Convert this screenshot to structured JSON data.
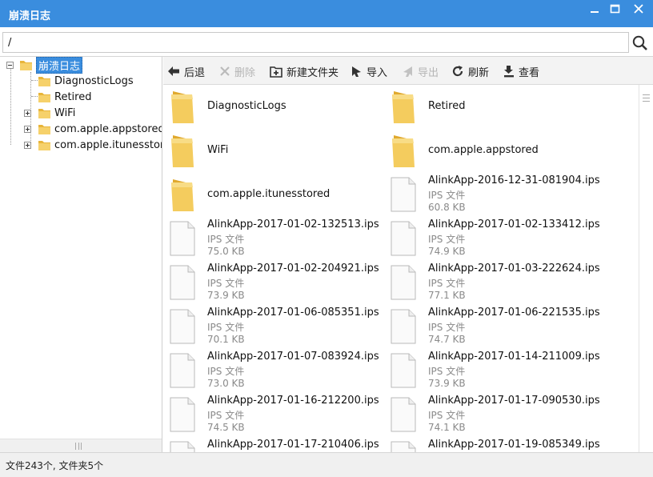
{
  "window": {
    "title": "崩溃日志",
    "accent_color": "#3a8dde",
    "controls": [
      "minimize-icon",
      "maximize-icon",
      "close-icon"
    ]
  },
  "path_bar": {
    "value": "/",
    "search_icon": "search-icon"
  },
  "tree": {
    "root": {
      "label": "崩溃日志",
      "expanded": true,
      "selected": true
    },
    "children": [
      {
        "label": "DiagnosticLogs",
        "expandable": false
      },
      {
        "label": "Retired",
        "expandable": false
      },
      {
        "label": "WiFi",
        "expandable": true
      },
      {
        "label": "com.apple.appstored",
        "expandable": true
      },
      {
        "label": "com.apple.itunesstored",
        "expandable": true
      }
    ]
  },
  "toolbar": {
    "back": {
      "label": "后退",
      "icon": "arrow-left-icon",
      "enabled": true
    },
    "delete": {
      "label": "删除",
      "icon": "delete-x-icon",
      "enabled": false
    },
    "new_folder": {
      "label": "新建文件夹",
      "icon": "new-folder-icon",
      "enabled": true
    },
    "import": {
      "label": "导入",
      "icon": "import-icon",
      "enabled": true
    },
    "export": {
      "label": "导出",
      "icon": "export-icon",
      "enabled": false
    },
    "refresh": {
      "label": "刷新",
      "icon": "refresh-icon",
      "enabled": true
    },
    "view": {
      "label": "查看",
      "icon": "view-icon",
      "enabled": true
    }
  },
  "files": {
    "folders": [
      {
        "name": "DiagnosticLogs"
      },
      {
        "name": "Retired"
      },
      {
        "name": "WiFi"
      },
      {
        "name": "com.apple.appstored"
      },
      {
        "name": "com.apple.itunesstored"
      }
    ],
    "file_type_label": "IPS 文件",
    "files": [
      {
        "name": "AlinkApp-2016-12-31-081904.ips",
        "size": "60.8 KB"
      },
      {
        "name": "AlinkApp-2017-01-02-132513.ips",
        "size": "75.0 KB"
      },
      {
        "name": "AlinkApp-2017-01-02-133412.ips",
        "size": "74.9 KB"
      },
      {
        "name": "AlinkApp-2017-01-02-204921.ips",
        "size": "73.9 KB"
      },
      {
        "name": "AlinkApp-2017-01-03-222624.ips",
        "size": "77.1 KB"
      },
      {
        "name": "AlinkApp-2017-01-06-085351.ips",
        "size": "70.1 KB"
      },
      {
        "name": "AlinkApp-2017-01-06-221535.ips",
        "size": "74.7 KB"
      },
      {
        "name": "AlinkApp-2017-01-07-083924.ips",
        "size": "73.0 KB"
      },
      {
        "name": "AlinkApp-2017-01-14-211009.ips",
        "size": "73.9 KB"
      },
      {
        "name": "AlinkApp-2017-01-16-212200.ips",
        "size": "74.5 KB"
      },
      {
        "name": "AlinkApp-2017-01-17-090530.ips",
        "size": "74.1 KB"
      },
      {
        "name": "AlinkApp-2017-01-17-210406.ips",
        "size": ""
      },
      {
        "name": "AlinkApp-2017-01-19-085349.ips",
        "size": ""
      }
    ]
  },
  "status": {
    "text": "文件243个, 文件夹5个"
  }
}
